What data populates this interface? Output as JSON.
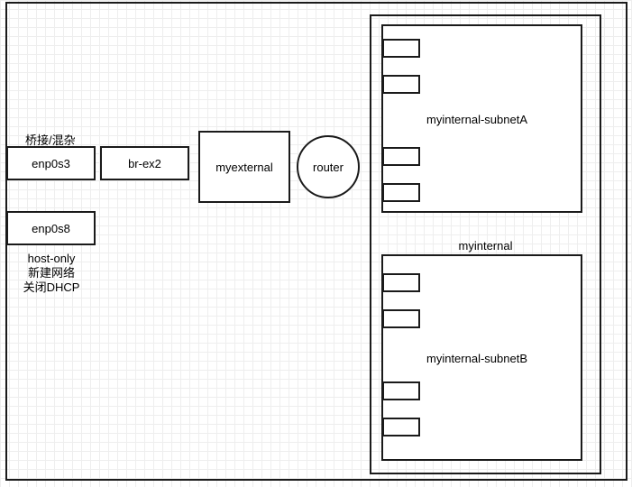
{
  "left_labels": {
    "bridge_note": "桥接/混杂",
    "host_only_note": [
      "host-only",
      "新建网络",
      "关闭DHCP"
    ]
  },
  "nodes": {
    "enp0s3": "enp0s3",
    "br_ex2": "br-ex2",
    "enp0s8": "enp0s8",
    "myexternal": "myexternal",
    "router": "router"
  },
  "internal": {
    "label": "myinternal",
    "subnet_a": "myinternal-subnetA",
    "subnet_b": "myinternal-subnetB"
  }
}
